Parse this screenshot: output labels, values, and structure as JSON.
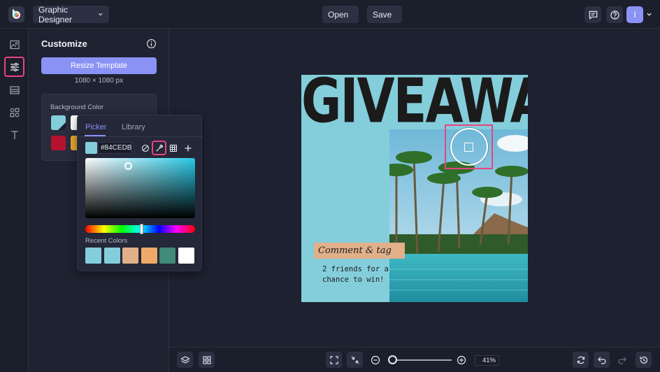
{
  "topbar": {
    "role_selector": "Graphic Designer",
    "open_label": "Open",
    "save_label": "Save",
    "avatar_initial": "I",
    "icons": [
      "comment-icon",
      "help-icon"
    ]
  },
  "rail": {
    "items": [
      {
        "icon": "image-icon",
        "active": false
      },
      {
        "icon": "sliders-icon",
        "active": true
      },
      {
        "icon": "layout-icon",
        "active": false
      },
      {
        "icon": "elements-icon",
        "active": false
      },
      {
        "icon": "text-icon",
        "active": false
      }
    ]
  },
  "panel": {
    "title": "Customize",
    "resize_label": "Resize Template",
    "dimensions": "1080 × 1080 px",
    "bg_color_label": "Background Color",
    "bg_swatches": [
      "#84cedb",
      "#ffffff",
      "#b31330",
      "#e8a830"
    ]
  },
  "color_picker": {
    "tabs": [
      "Picker",
      "Library"
    ],
    "active_tab": "Picker",
    "hex_value": "#84CEDB",
    "current_color": "#84cedb",
    "tools": [
      "no-color-icon",
      "eyedropper-icon",
      "grid-icon",
      "plus-icon"
    ],
    "active_tool": "eyedropper-icon",
    "recent_label": "Recent Colors",
    "recent_colors": [
      "#84cedb",
      "#84cedb",
      "#e1b08b",
      "#eeaa6a",
      "#3f8a78",
      "#ffffff"
    ]
  },
  "artboard": {
    "headline": "GIVEAWAY",
    "tag_text": "Comment & tag",
    "body_text_1": "2 friends for a",
    "body_text_2": "chance to win!",
    "background": "#84cedb"
  },
  "bottombar": {
    "zoom": "41%",
    "icons": [
      "layers-icon",
      "grid-view-icon",
      "fit-icon",
      "shrink-icon",
      "zoom-out-icon",
      "zoom-in-icon",
      "sync-icon",
      "undo-icon",
      "redo-icon",
      "history-icon"
    ]
  },
  "colors": {
    "accent": "#8b92f5",
    "highlight": "#e8457f"
  }
}
